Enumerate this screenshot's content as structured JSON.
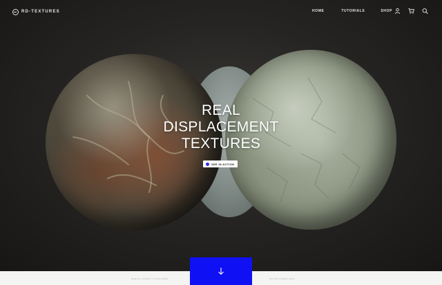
{
  "brand": {
    "name": "RD-TEXTURES"
  },
  "nav": {
    "links": [
      "HOME",
      "TUTORIALS",
      "SHOP"
    ],
    "icons": [
      "user-icon",
      "cart-icon",
      "search-icon"
    ]
  },
  "hero": {
    "headline_lines": [
      "REAL",
      "DISPLACEMENT",
      "TEXTURES"
    ],
    "cta_label": "SEE IN ACTION",
    "accent_color": "#0f10f4"
  },
  "footer": {
    "left_note": "SCROLL DOWN TO EXPLORE",
    "right_note": "RD-TEXTURES 2024",
    "scroll_icon": "arrow-down-icon"
  }
}
